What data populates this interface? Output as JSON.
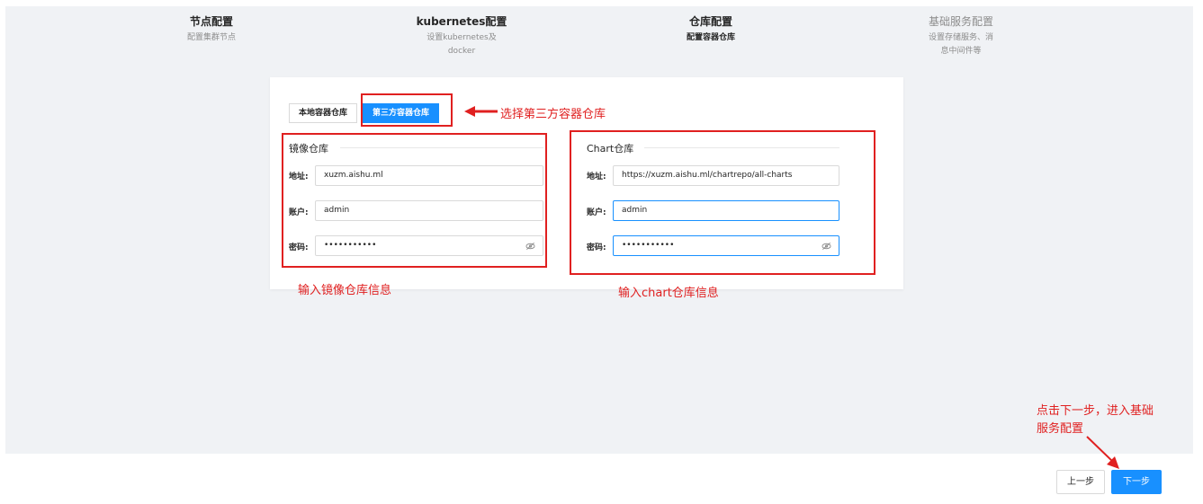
{
  "steps": [
    {
      "title": "节点配置",
      "desc": "配置集群节点"
    },
    {
      "title": "kubernetes配置",
      "desc_line1": "设置kubernetes及",
      "desc_line2": "docker"
    },
    {
      "title": "仓库配置",
      "desc": "配置容器仓库"
    },
    {
      "title": "基础服务配置",
      "desc_line1": "设置存储服务、消",
      "desc_line2": "息中间件等"
    }
  ],
  "tabs": {
    "local": "本地容器仓库",
    "third_party": "第三方容器仓库"
  },
  "image_repo": {
    "title": "镜像仓库",
    "address_label": "地址:",
    "address_value": "xuzm.aishu.ml",
    "account_label": "账户:",
    "account_value": "admin",
    "password_label": "密码:",
    "password_value": "•••••••••••"
  },
  "chart_repo": {
    "title": "Chart仓库",
    "address_label": "地址:",
    "address_value": "https://xuzm.aishu.ml/chartrepo/all-charts",
    "account_label": "账户:",
    "account_value": "admin",
    "password_label": "密码:",
    "password_value": "•••••••••••"
  },
  "annotations": {
    "select_third": "选择第三方容器仓库",
    "image_info": "输入镜像仓库信息",
    "chart_info": "输入chart仓库信息",
    "next_tip_line1": "点击下一步，进入基础",
    "next_tip_line2": "服务配置"
  },
  "footer": {
    "prev": "上一步",
    "next": "下一步"
  },
  "colors": {
    "primary": "#1890ff",
    "annotation": "#e02020"
  },
  "icons": {
    "password_toggle": "eye-invisible-icon"
  }
}
